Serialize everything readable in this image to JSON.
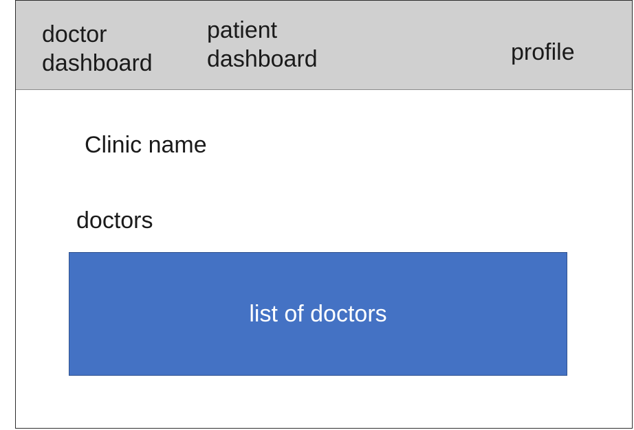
{
  "nav": {
    "doctor_dashboard": {
      "line1": "doctor",
      "line2": "dashboard"
    },
    "patient_dashboard": {
      "line1": "patient",
      "line2": "dashboard"
    },
    "profile": "profile"
  },
  "main": {
    "clinic_name": "Clinic name",
    "doctors_heading": "doctors",
    "doctor_list_label": "list of doctors"
  },
  "colors": {
    "topbar": "#d0d0d0",
    "doctor_list_fill": "#4472c4",
    "doctor_list_border": "#2f528f",
    "doctor_list_text": "#ffffff"
  }
}
